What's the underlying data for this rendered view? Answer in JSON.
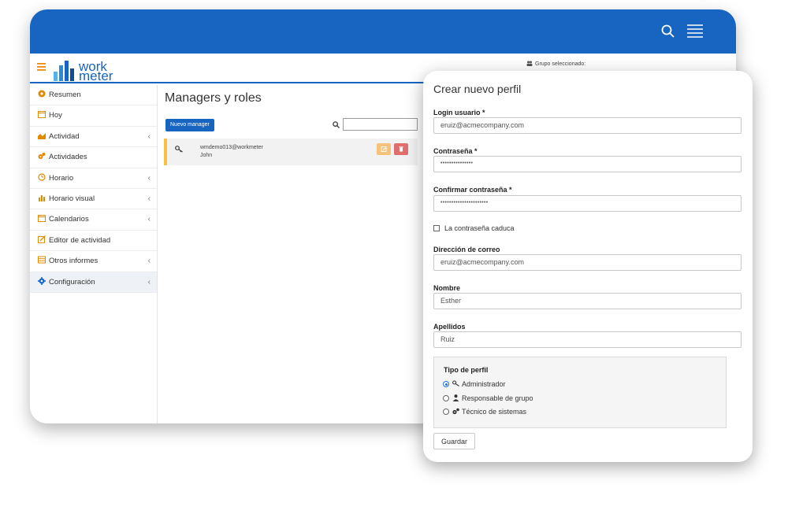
{
  "back_window": {
    "header": {
      "group_selected_label": "Grupo seleccionado:",
      "logo_line1": "work",
      "logo_line2": "meter"
    },
    "sidebar": {
      "items": [
        {
          "label": "Resumen",
          "icon": "dashboard-icon",
          "icon_color": "#e08a00",
          "has_submenu": false
        },
        {
          "label": "Hoy",
          "icon": "calendar-icon",
          "icon_color": "#e08a00",
          "has_submenu": false
        },
        {
          "label": "Actividad",
          "icon": "area-chart-icon",
          "icon_color": "#e08a00",
          "has_submenu": true
        },
        {
          "label": "Actividades",
          "icon": "gears-icon",
          "icon_color": "#e08a00",
          "has_submenu": false
        },
        {
          "label": "Horario",
          "icon": "clock-icon",
          "icon_color": "#e08a00",
          "has_submenu": true
        },
        {
          "label": "Horario visual",
          "icon": "bar-chart-icon",
          "icon_color": "#e08a00",
          "has_submenu": true
        },
        {
          "label": "Calendarios",
          "icon": "calendar-icon",
          "icon_color": "#e08a00",
          "has_submenu": true
        },
        {
          "label": "Editor de actividad",
          "icon": "edit-icon",
          "icon_color": "#e08a00",
          "has_submenu": false
        },
        {
          "label": "Otros informes",
          "icon": "table-icon",
          "icon_color": "#e08a00",
          "has_submenu": true
        },
        {
          "label": "Configuración",
          "icon": "cog-icon",
          "icon_color": "#1765c1",
          "has_submenu": true,
          "active": true
        }
      ]
    },
    "main": {
      "title": "Managers y roles",
      "new_manager_label": "Nuevo manager",
      "search_value": "",
      "managers": [
        {
          "email": "wmdemo013@workmeter",
          "name": "John"
        }
      ]
    }
  },
  "form": {
    "title": "Crear nuevo perfil",
    "login_label": "Login usuario *",
    "login_value": "eruiz@acmecompany.com",
    "password_label": "Contraseña *",
    "password_value": "•••••••••••••••",
    "confirm_label": "Confirmar contraseña *",
    "confirm_value": "••••••••••••••••••••••",
    "expires_label": "La contraseña caduca",
    "expires_checked": false,
    "email_label": "Dirección de correo",
    "email_value": "eruiz@acmecompany.com",
    "name_label": "Nombre",
    "name_value": "Esther",
    "surname_label": "Apellidos",
    "surname_value": "Ruiz",
    "profile_type_label": "Tipo de perfil",
    "profile_options": [
      {
        "label": "Administrador",
        "icon": "key-icon",
        "selected": true
      },
      {
        "label": "Responsable de grupo",
        "icon": "user-icon",
        "selected": false
      },
      {
        "label": "Técnico de sistemas",
        "icon": "gears-icon",
        "selected": false
      }
    ],
    "save_label": "Guardar"
  },
  "colors": {
    "primary_blue": "#1765c1",
    "accent_orange": "#f08a00",
    "row_highlight": "#f7c244",
    "edit_button": "#f4c27a",
    "delete_button": "#e16e6e"
  }
}
